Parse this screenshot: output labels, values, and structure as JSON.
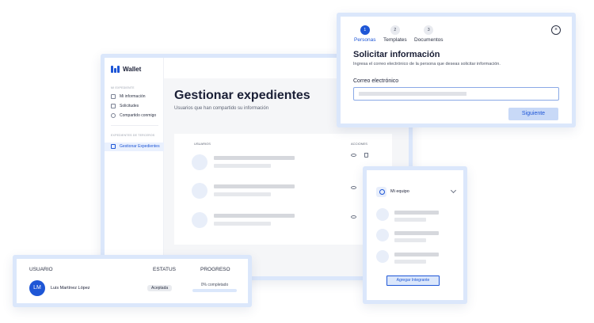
{
  "colors": {
    "accent": "#1e56d6",
    "frame": "#dbe7fb"
  },
  "app": {
    "logo_text": "Wallet",
    "sidebar": {
      "section_1": "Mi expediente",
      "items": [
        {
          "label": "Mi información",
          "icon": "lock-icon"
        },
        {
          "label": "Solicitudes",
          "icon": "inbox-icon"
        },
        {
          "label": "Compartido conmigo",
          "icon": "share-icon"
        }
      ],
      "section_2": "Expedientes de terceros",
      "active_item": {
        "label": "Gestionar Expedientes",
        "icon": "folder-icon"
      }
    },
    "title": "Gestionar expedientes",
    "subtitle": "Usuarios que han compartido su información",
    "table": {
      "col_users": "Usuarios",
      "col_actions": "Acciones",
      "row_count": 3
    }
  },
  "modal": {
    "steps": [
      {
        "number": "1",
        "label": "Personas"
      },
      {
        "number": "2",
        "label": "Templates"
      },
      {
        "number": "3",
        "label": "Documentos"
      }
    ],
    "close_symbol": "×",
    "title": "Solicitar información",
    "subtitle": "Ingresa el correo electrónico de la persona que deseas solicitar información.",
    "field_label": "Correo electrónico",
    "button": "Siguiente"
  },
  "team": {
    "name": "Mi equipo",
    "button": "Agregar Integrante"
  },
  "users": {
    "headers": {
      "user": "Usuario",
      "status": "Estatus",
      "progress": "Progreso"
    },
    "row": {
      "initials": "LM",
      "name": "Luis Martínez López",
      "status": "Aceptada",
      "progress_text": "0% completado",
      "progress_value": 0
    }
  }
}
